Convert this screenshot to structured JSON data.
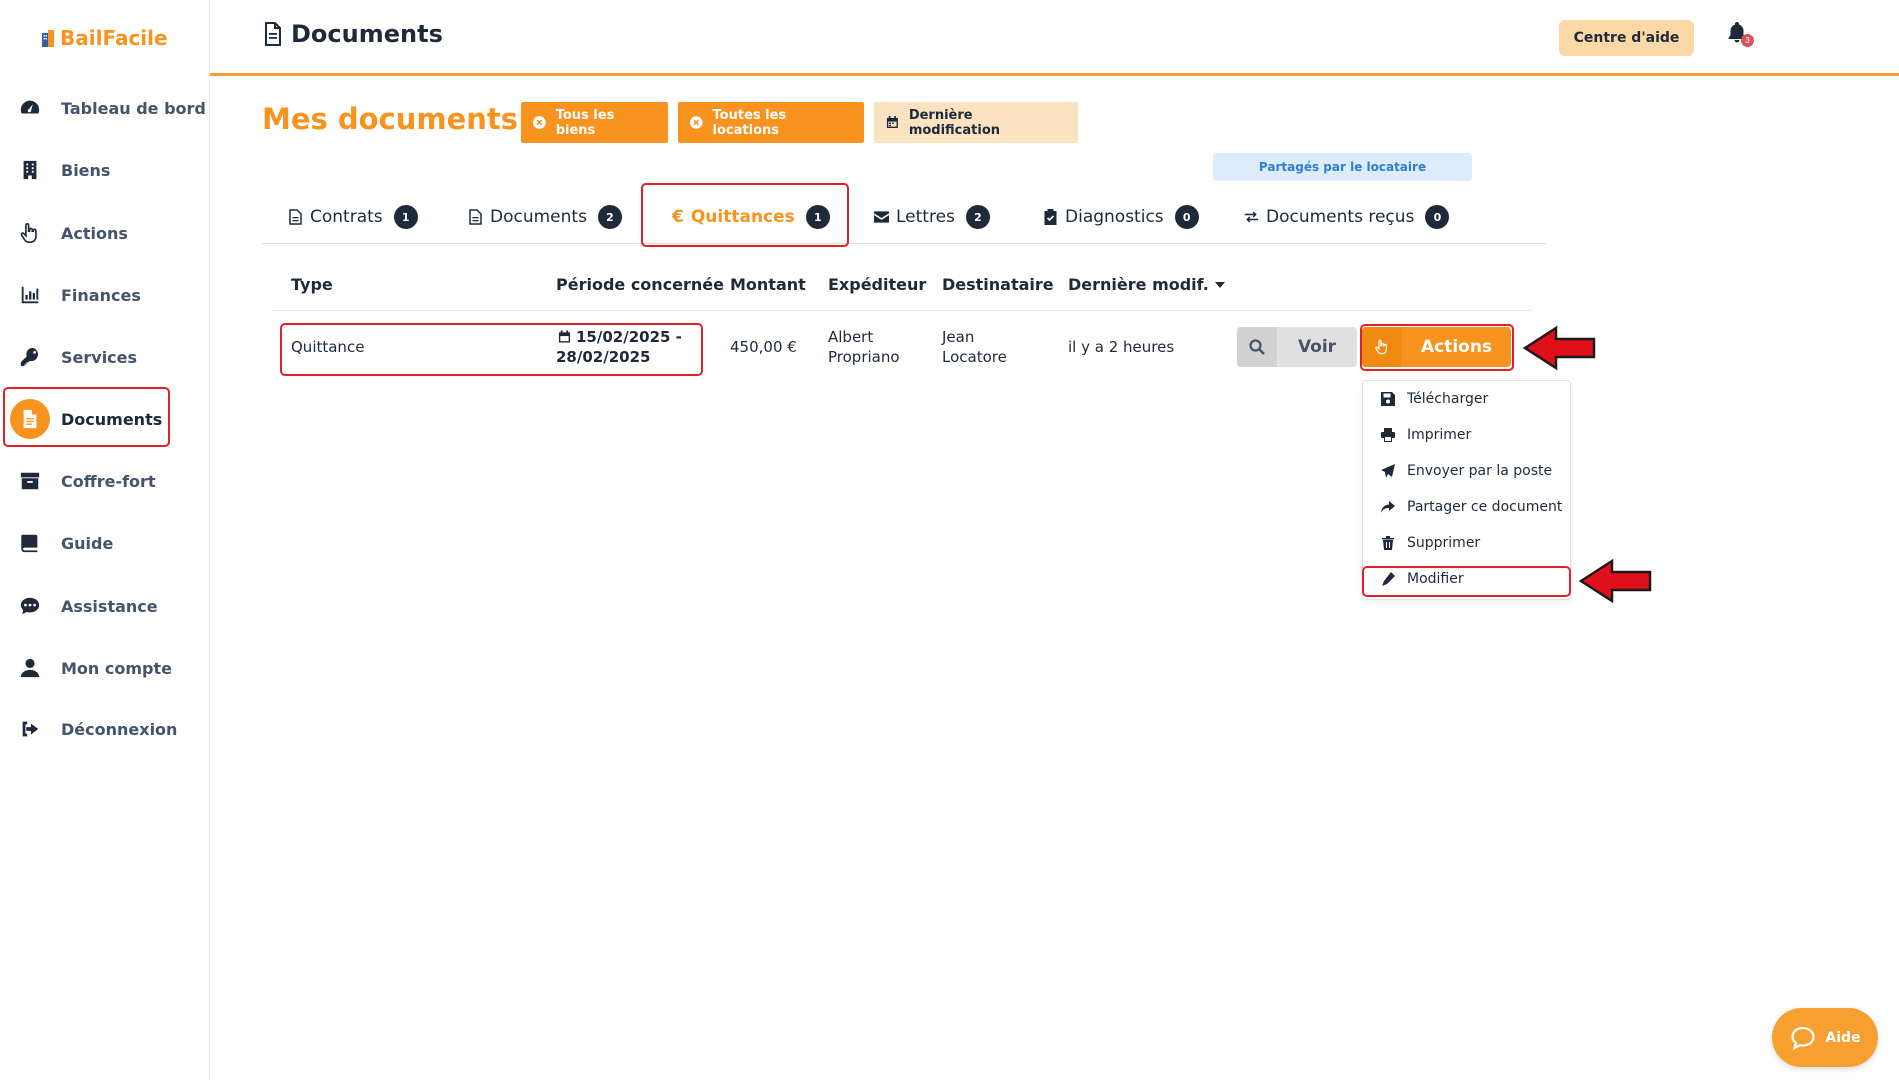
{
  "brand": {
    "name": "BailFacile"
  },
  "sidebar": {
    "items": [
      {
        "label": "Tableau de bord",
        "icon": "gauge-icon"
      },
      {
        "label": "Biens",
        "icon": "building-icon"
      },
      {
        "label": "Actions",
        "icon": "hand-pointer-icon"
      },
      {
        "label": "Finances",
        "icon": "bar-chart-icon"
      },
      {
        "label": "Services",
        "icon": "key-icon"
      },
      {
        "label": "Documents",
        "icon": "file-icon",
        "active": true
      },
      {
        "label": "Coffre-fort",
        "icon": "archive-box-icon"
      },
      {
        "label": "Guide",
        "icon": "book-icon"
      },
      {
        "label": "Assistance",
        "icon": "chat-icon"
      },
      {
        "label": "Mon compte",
        "icon": "user-icon"
      },
      {
        "label": "Déconnexion",
        "icon": "logout-icon"
      }
    ]
  },
  "header": {
    "title": "Documents",
    "help_label": "Centre d'aide",
    "notification_count": "3"
  },
  "main": {
    "heading": "Mes documents",
    "filters": [
      {
        "label": "Tous les biens",
        "icon": "circle-x-icon"
      },
      {
        "label": "Toutes les locations",
        "icon": "circle-x-icon"
      },
      {
        "label": "Dernière modification",
        "icon": "calendar-icon"
      }
    ],
    "shared_badge": "Partagés par le locataire",
    "tabs": [
      {
        "label": "Contrats",
        "count": "1"
      },
      {
        "label": "Documents",
        "count": "2"
      },
      {
        "label": "Quittances",
        "count": "1",
        "active": true,
        "prefix": "€"
      },
      {
        "label": "Lettres",
        "count": "2"
      },
      {
        "label": "Diagnostics",
        "count": "0"
      },
      {
        "label": "Documents reçus",
        "count": "0"
      }
    ],
    "table": {
      "columns": [
        "Type",
        "Période concernée",
        "Montant",
        "Expéditeur",
        "Destinataire",
        "Dernière modif."
      ],
      "rows": [
        {
          "type": "Quittance",
          "period_line1": "15/02/2025 -",
          "period_line2": "28/02/2025",
          "amount": "450,00 €",
          "sender_line1": "Albert",
          "sender_line2": "Propriano",
          "recipient_line1": "Jean",
          "recipient_line2": "Locatore",
          "modified": "il y a 2 heures",
          "view_label": "Voir",
          "actions_label": "Actions"
        }
      ]
    },
    "actions_menu": [
      {
        "label": "Télécharger",
        "icon": "floppy-disk-icon"
      },
      {
        "label": "Imprimer",
        "icon": "printer-icon"
      },
      {
        "label": "Envoyer par la poste",
        "icon": "paper-plane-icon"
      },
      {
        "label": "Partager ce document",
        "icon": "share-arrow-icon"
      },
      {
        "label": "Supprimer",
        "icon": "trash-icon"
      },
      {
        "label": "Modifier",
        "icon": "pencil-icon"
      }
    ]
  },
  "aide_button": {
    "label": "Aide"
  },
  "colors": {
    "accent": "#f7931e",
    "navy": "#1e2a3a",
    "highlight": "#e0202a"
  }
}
